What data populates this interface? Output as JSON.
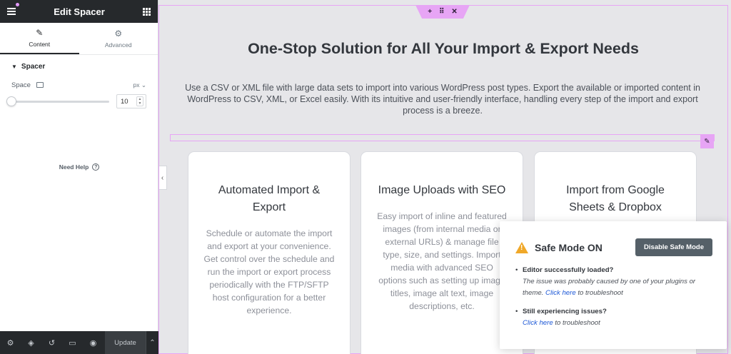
{
  "panel": {
    "title": "Edit Spacer",
    "tabs": [
      {
        "label": "Content",
        "icon": "pencil-icon"
      },
      {
        "label": "Advanced",
        "icon": "gear-icon"
      }
    ],
    "section_label": "Spacer",
    "space": {
      "label": "Space",
      "unit": "px",
      "value": "10"
    },
    "need_help": "Need Help",
    "footer": {
      "update_label": "Update",
      "icons": [
        "settings-icon",
        "layers-icon",
        "history-icon",
        "responsive-icon",
        "preview-icon"
      ]
    }
  },
  "canvas": {
    "title": "One-Stop Solution for All Your Import & Export Needs",
    "description": "Use a CSV or XML file with large data sets to import into various WordPress post types. Export the available or imported content in WordPress to CSV, XML, or Excel easily. With its intuitive and user-friendly interface, handling every step of the import and export process is a breeze.",
    "cards": [
      {
        "title": "Automated Import & Export",
        "text": "Schedule or automate the import and export at your convenience. Get control over the schedule and run the import or export process periodically with the FTP/SFTP host configuration for a better experience."
      },
      {
        "title": "Image Uploads with SEO",
        "text": "Easy import of inline and featured images (from internal media or external URLs) & manage file type, size, and settings. Import media with advanced SEO options such as setting up image titles, image alt text, image descriptions, etc."
      },
      {
        "title": "Import from Google Sheets & Dropbox",
        "text": ""
      }
    ]
  },
  "safe_mode": {
    "title": "Safe Mode ON",
    "button": "Disable Safe Mode",
    "item1_head": "Editor successfully loaded?",
    "item1_body": "The issue was probably caused by one of your plugins or theme.",
    "item1_link": "Click here",
    "item1_tail": "to troubleshoot",
    "item2_head": "Still experiencing issues?",
    "item2_link": "Click here",
    "item2_tail": "to troubleshoot"
  },
  "colors": {
    "accent_outline": "#e7a5f5",
    "panel_dark": "#26292c",
    "canvas_bg": "#e6e6e9",
    "warning": "#f0a829",
    "link": "#1a56d6"
  }
}
